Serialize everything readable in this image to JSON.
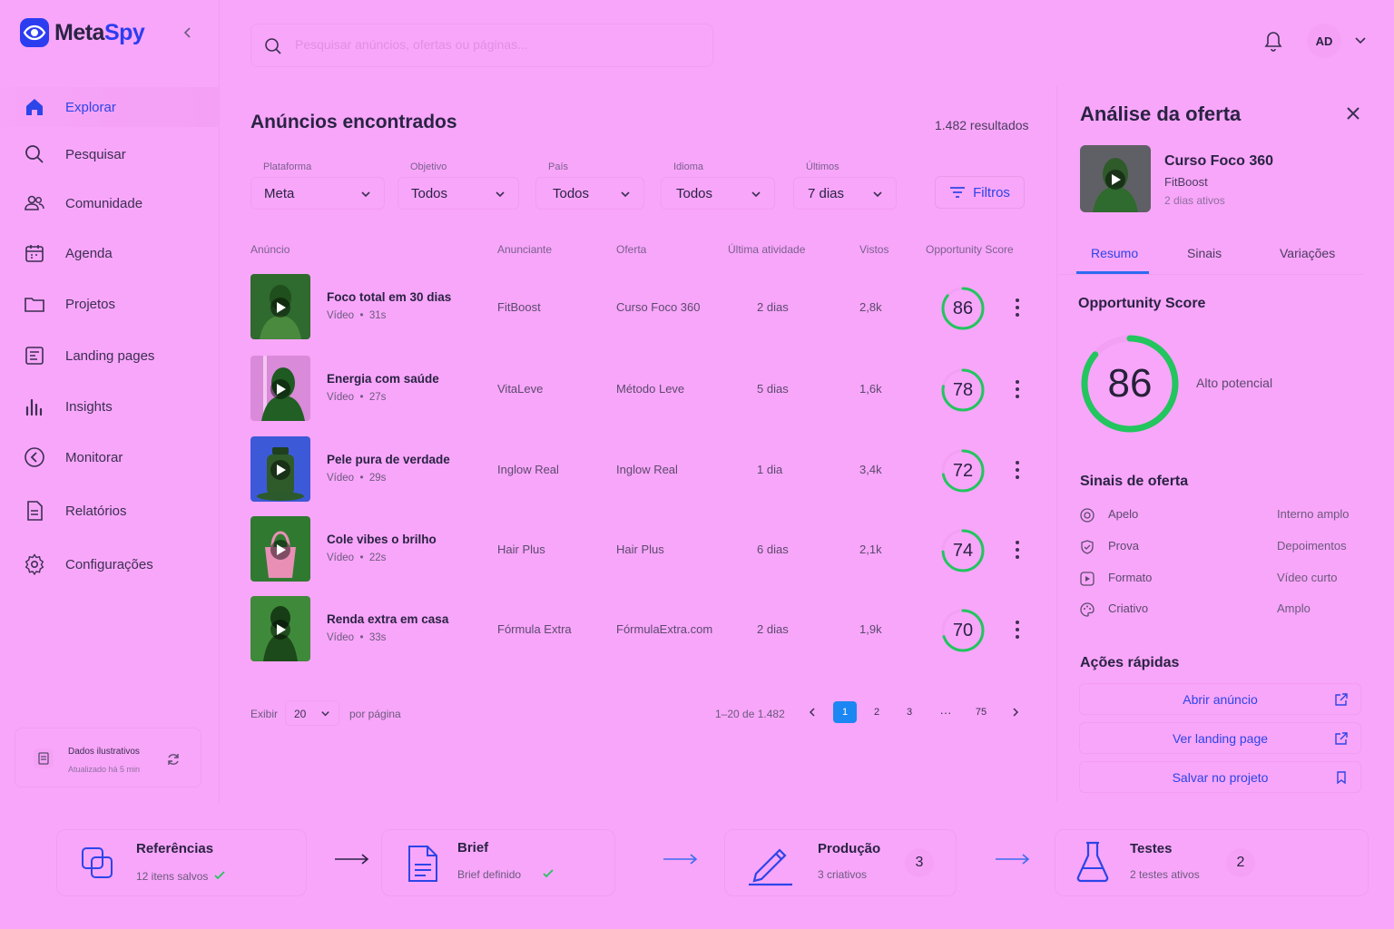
{
  "app": {
    "name_part1": "Meta",
    "name_part2": "Spy",
    "collapse_icon": "chevrons-left-icon"
  },
  "sidebar": {
    "items": [
      {
        "label": "Explorar",
        "icon": "home-icon",
        "active": true
      },
      {
        "label": "Pesquisar",
        "icon": "search-icon"
      },
      {
        "label": "Comunidade",
        "icon": "users-icon"
      },
      {
        "label": "Agenda",
        "icon": "calendar-icon"
      },
      {
        "label": "Projetos",
        "icon": "folder-icon"
      },
      {
        "label": "Landing pages",
        "icon": "layout-icon"
      },
      {
        "label": "Insights",
        "icon": "bar-chart-icon"
      },
      {
        "label": "Monitorar",
        "icon": "arrow-circle-icon"
      },
      {
        "label": "Relatórios",
        "icon": "file-icon"
      },
      {
        "label": "Configurações",
        "icon": "gear-icon"
      }
    ],
    "data_box": {
      "title": "Dados ilustrativos",
      "updated": "Atualizado há 5 min"
    }
  },
  "header": {
    "search_placeholder": "Pesquisar anúncios, ofertas ou páginas...",
    "avatar_initials": "AD"
  },
  "main": {
    "title": "Anúncios encontrados",
    "results": "1.482 resultados",
    "filters": [
      {
        "label": "Plataforma",
        "value": "Meta"
      },
      {
        "label": "Objetivo",
        "value": "Todos"
      },
      {
        "label": "País",
        "value": "Todos"
      },
      {
        "label": "Idioma",
        "value": "Todos"
      },
      {
        "label": "Últimos",
        "value": "7 dias"
      }
    ],
    "filters_button": "Filtros",
    "columns": [
      "Anúncio",
      "Anunciante",
      "Oferta",
      "Última atividade",
      "Vistos",
      "Opportunity Score"
    ],
    "rows": [
      {
        "title": "Foco total em 30 dias",
        "type": "Vídeo",
        "duration": "31s",
        "advertiser": "FitBoost",
        "offer": "Curso Foco 360",
        "last": "2 dias",
        "views": "2,8k",
        "score": 86
      },
      {
        "title": "Energia com saúde",
        "type": "Vídeo",
        "duration": "27s",
        "advertiser": "VitaLeve",
        "offer": "Método Leve",
        "last": "5 dias",
        "views": "1,6k",
        "score": 78
      },
      {
        "title": "Pele pura de verdade",
        "type": "Vídeo",
        "duration": "29s",
        "advertiser": "Inglow Real",
        "offer": "Inglow Real",
        "last": "1 dia",
        "views": "3,4k",
        "score": 72
      },
      {
        "title": "Cole vibes o brilho",
        "type": "Vídeo",
        "duration": "22s",
        "advertiser": "Hair Plus",
        "offer": "Hair Plus",
        "last": "6 dias",
        "views": "2,1k",
        "score": 74
      },
      {
        "title": "Renda extra em casa",
        "type": "Vídeo",
        "duration": "33s",
        "advertiser": "Fórmula Extra",
        "offer": "FórmulaExtra.com",
        "last": "2 dias",
        "views": "1,9k",
        "score": 70
      }
    ],
    "pagination": {
      "show_label": "Exibir",
      "per_page": "20",
      "per_page_label": "por página",
      "range": "1–20 de 1.482",
      "pages": [
        "1",
        "2",
        "3",
        "···",
        "75"
      ],
      "current": "1"
    }
  },
  "panel": {
    "title": "Análise da oferta",
    "offer_name": "Curso Foco 360",
    "advertiser": "FitBoost",
    "active": "2 dias ativos",
    "tabs": [
      "Resumo",
      "Sinais",
      "Variações"
    ],
    "score_title": "Opportunity Score",
    "score": 86,
    "score_label": "Alto potencial",
    "signals_title": "Sinais de oferta",
    "signals": [
      {
        "label": "Apelo",
        "value": "Interno amplo",
        "icon": "target-icon"
      },
      {
        "label": "Prova",
        "value": "Depoimentos",
        "icon": "shield-check-icon"
      },
      {
        "label": "Formato",
        "value": "Vídeo curto",
        "icon": "play-square-icon"
      },
      {
        "label": "Criativo",
        "value": "Amplo",
        "icon": "palette-icon"
      }
    ],
    "actions_title": "Ações rápidas",
    "actions": [
      {
        "label": "Abrir anúncio",
        "icon": "external-link-icon"
      },
      {
        "label": "Ver landing page",
        "icon": "external-link-icon"
      },
      {
        "label": "Salvar no projeto",
        "icon": "bookmark-icon"
      }
    ]
  },
  "workflow": [
    {
      "title": "Referências",
      "sub": "12 itens salvos",
      "icon": "copy-icon",
      "check": true
    },
    {
      "title": "Brief",
      "sub": "Brief definido",
      "icon": "document-icon",
      "check": true
    },
    {
      "title": "Produção",
      "sub": "3 criativos",
      "icon": "pencil-icon",
      "badge": "3"
    },
    {
      "title": "Testes",
      "sub": "2 testes ativos",
      "icon": "flask-icon",
      "badge": "2"
    }
  ],
  "colors": {
    "accent": "#2c45e8",
    "score_green": "#22c55e",
    "background": "#f8a6f9"
  }
}
